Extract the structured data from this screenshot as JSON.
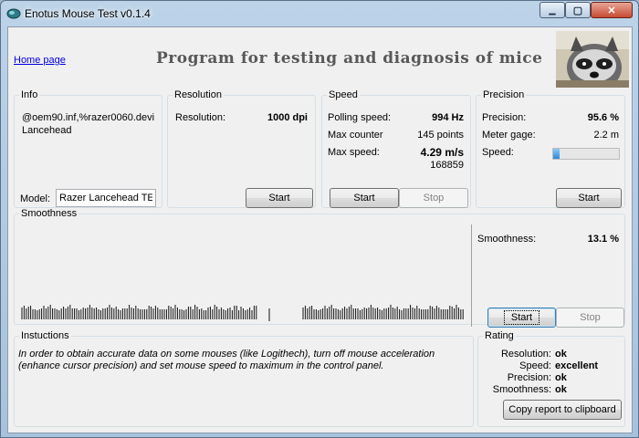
{
  "window": {
    "title": "Enotus Mouse Test v0.1.4",
    "controls": {
      "minimize": "▁",
      "maximize": "▢",
      "close": "✕"
    }
  },
  "header": {
    "home_link": "Home page",
    "headline": "Program for testing and diagnosis of mice"
  },
  "info": {
    "legend": "Info",
    "device_id_line1": "@oem90.inf,%razer0060.devi",
    "device_id_line2": "Lancehead",
    "model_label": "Model:",
    "model_value": "Razer Lancehead TE"
  },
  "resolution": {
    "legend": "Resolution",
    "label": "Resolution:",
    "value": "1000 dpi",
    "start_label": "Start"
  },
  "speed": {
    "legend": "Speed",
    "polling_label": "Polling speed:",
    "polling_value": "994 Hz",
    "max_counter_label": "Max counter",
    "max_counter_value": "145 points",
    "max_speed_label": "Max  speed:",
    "max_speed_value": "4.29 m/s",
    "max_speed_sub": "168859",
    "start_label": "Start",
    "stop_label": "Stop"
  },
  "precision": {
    "legend": "Precision",
    "precision_label": "Precision:",
    "precision_value": "95.6 %",
    "meter_label": "Meter gage:",
    "meter_value": "2.2 m",
    "speed_label": "Speed:",
    "speed_level": 0.1,
    "start_label": "Start"
  },
  "smoothness": {
    "legend": "Smoothness",
    "label": "Smoothness:",
    "value": "13.1 %",
    "start_label": "Start",
    "stop_label": "Stop"
  },
  "instructions": {
    "legend": "Instuctions",
    "text_line1": "In order to obtain accurate data on some mouses (like Logithech), turn off mouse acceleration",
    "text_line2": "(enhance cursor precision) and set mouse speed to maximum in the control panel."
  },
  "rating": {
    "legend": "Rating",
    "items": [
      {
        "label": "Resolution:",
        "value": "ok"
      },
      {
        "label": "Speed:",
        "value": "excellent"
      },
      {
        "label": "Precision:",
        "value": "ok"
      },
      {
        "label": "Smoothness:",
        "value": "ok"
      }
    ],
    "copy_label": "Copy report to clipboard"
  }
}
